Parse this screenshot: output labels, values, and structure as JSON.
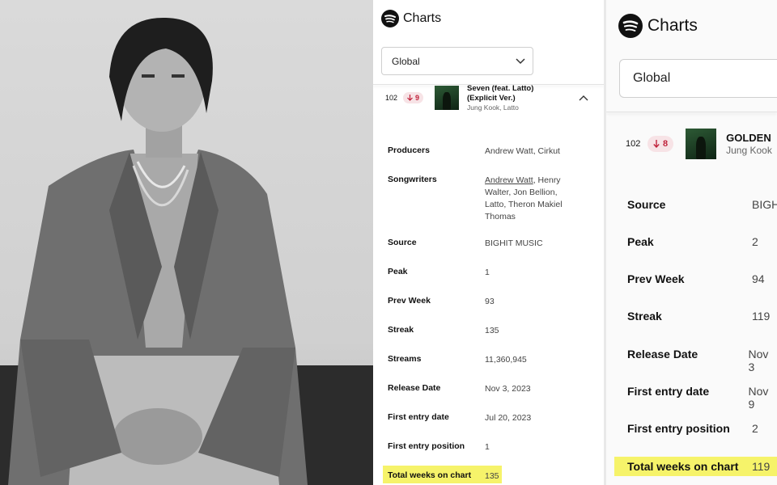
{
  "left_panel": {
    "brand": "Charts",
    "region_select": "Global",
    "track": {
      "rank": "102",
      "movement": "9",
      "title_line1": "Seven (feat. Latto)",
      "title_line2": "(Explicit Ver.)",
      "artists": "Jung Kook, Latto"
    },
    "details": [
      {
        "label": "Producers",
        "value": "Andrew Watt, Cirkut"
      },
      {
        "label": "Songwriters",
        "value_link": "Andrew Watt",
        "value_rest": ", Henry Walter, Jon Bellion, Latto, Theron Makiel Thomas"
      },
      {
        "label": "Source",
        "value": "BIGHIT MUSIC"
      },
      {
        "label": "Peak",
        "value": "1"
      },
      {
        "label": "Prev Week",
        "value": "93"
      },
      {
        "label": "Streak",
        "value": "135"
      },
      {
        "label": "Streams",
        "value": "11,360,945"
      },
      {
        "label": "Release Date",
        "value": "Nov 3, 2023"
      },
      {
        "label": "First entry date",
        "value": "Jul 20, 2023"
      },
      {
        "label": "First entry position",
        "value": "1"
      },
      {
        "label": "Total weeks on chart",
        "value": "135"
      }
    ]
  },
  "right_panel": {
    "brand": "Charts",
    "region_select": "Global",
    "track": {
      "rank": "102",
      "movement": "8",
      "title": "GOLDEN",
      "artists": "Jung Kook"
    },
    "details": [
      {
        "label": "Source",
        "value": "BIGH"
      },
      {
        "label": "Peak",
        "value": "2"
      },
      {
        "label": "Prev Week",
        "value": "94"
      },
      {
        "label": "Streak",
        "value": "119"
      },
      {
        "label": "Release Date",
        "value": "Nov 3"
      },
      {
        "label": "First entry date",
        "value": "Nov 9"
      },
      {
        "label": "First entry position",
        "value": "2"
      },
      {
        "label": "Total weeks on chart",
        "value": "119"
      }
    ]
  },
  "colors": {
    "highlight": "#f6f36a",
    "down_badge_bg": "#f7e3e6",
    "down_badge_fg": "#c0223b"
  },
  "icons": [
    "spotify-logo-icon",
    "chevron-down-icon",
    "chevron-up-icon",
    "arrow-down-icon"
  ]
}
